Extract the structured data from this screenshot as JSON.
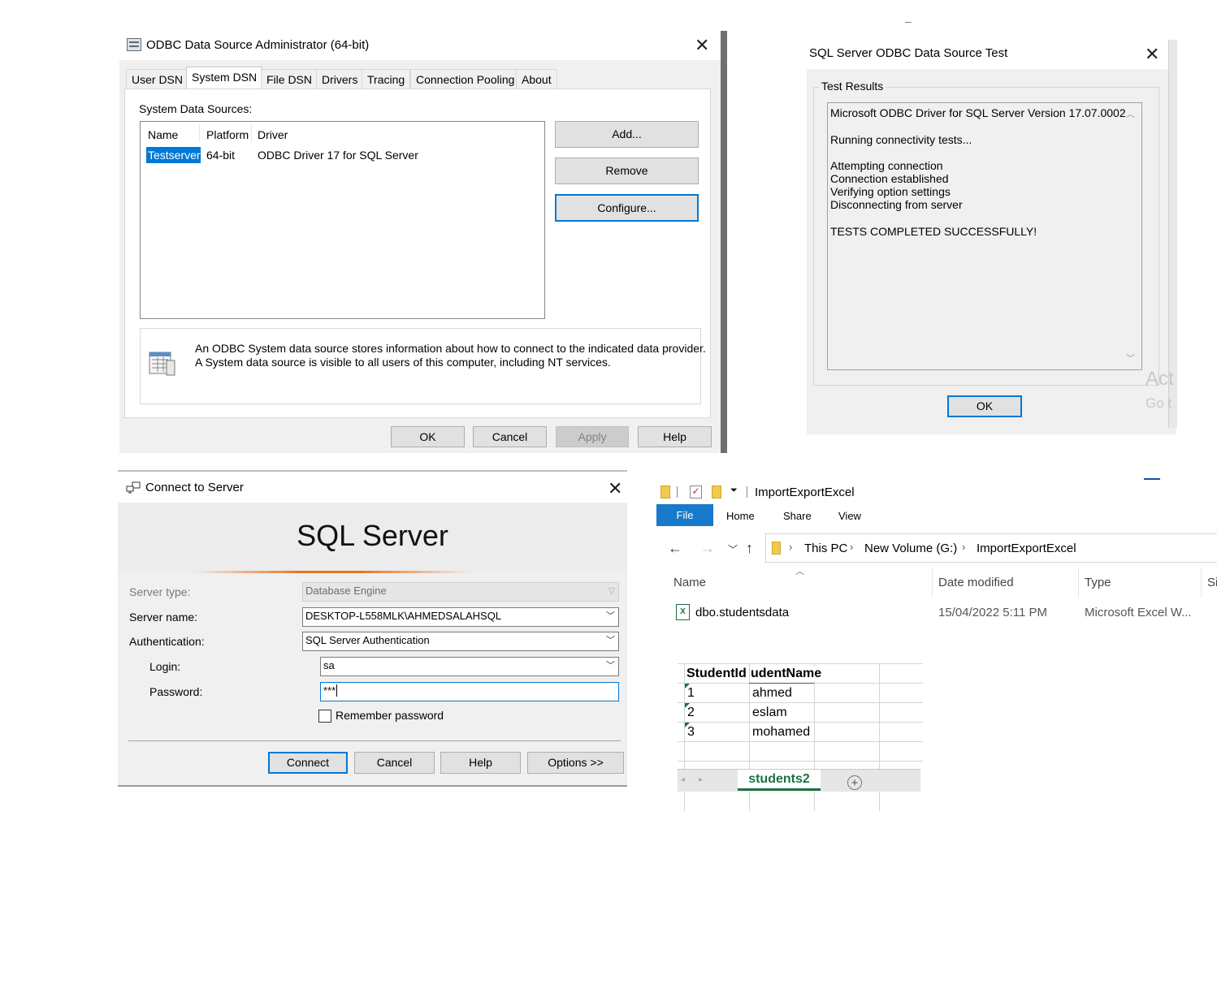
{
  "odbc": {
    "title": "ODBC Data Source Administrator (64-bit)",
    "tabs": [
      "User DSN",
      "System DSN",
      "File DSN",
      "Drivers",
      "Tracing",
      "Connection Pooling",
      "About"
    ],
    "active_tab": "System DSN",
    "section_label": "System Data Sources:",
    "columns": [
      "Name",
      "Platform",
      "Driver"
    ],
    "rows": [
      {
        "name": "Testserver",
        "platform": "64-bit",
        "driver": "ODBC Driver 17 for SQL Server"
      }
    ],
    "buttons": {
      "add": "Add...",
      "remove": "Remove",
      "configure": "Configure..."
    },
    "info_line1": "An ODBC System data source stores information about how to connect to the indicated data provider.",
    "info_line2": "A System data source is visible to all users of this computer, including NT services.",
    "footer": {
      "ok": "OK",
      "cancel": "Cancel",
      "apply": "Apply",
      "help": "Help"
    }
  },
  "test": {
    "title": "SQL Server ODBC Data Source Test",
    "group_label": "Test Results",
    "lines": {
      "version": "Microsoft ODBC Driver for SQL Server Version 17.07.0002",
      "running": "Running connectivity tests...",
      "attempting": "Attempting connection",
      "established": "Connection established",
      "verifying": "Verifying option settings",
      "disconnecting": "Disconnecting from server",
      "result": "TESTS COMPLETED SUCCESSFULLY!"
    },
    "ok": "OK",
    "watermark_1": "Act",
    "watermark_2": "Go t"
  },
  "connect": {
    "title": "Connect to Server",
    "banner": "SQL Server",
    "server_type_label": "Server type:",
    "server_type_value": "Database Engine",
    "server_name_label": "Server name:",
    "server_name_value": "DESKTOP-L558MLK\\AHMEDSALAHSQL",
    "auth_label": "Authentication:",
    "auth_value": "SQL Server Authentication",
    "login_label": "Login:",
    "login_value": "sa",
    "password_label": "Password:",
    "password_value": "***",
    "remember_label": "Remember password",
    "buttons": {
      "connect": "Connect",
      "cancel": "Cancel",
      "help": "Help",
      "options": "Options >>"
    }
  },
  "explorer": {
    "title": "ImportExportExcel",
    "ribbon_tabs": {
      "file": "File",
      "home": "Home",
      "share": "Share",
      "view": "View"
    },
    "breadcrumb": {
      "this_pc": "This PC",
      "volume": "New Volume (G:)",
      "folder": "ImportExportExcel"
    },
    "columns": {
      "name": "Name",
      "date": "Date modified",
      "type": "Type",
      "size": "Si"
    },
    "file": {
      "name": "dbo.studentsdata",
      "date": "15/04/2022 5:11 PM",
      "type": "Microsoft Excel W..."
    }
  },
  "sheet": {
    "headers": {
      "a": "StudentId",
      "b": "udentName"
    },
    "rows": [
      {
        "id": "1",
        "name": "ahmed"
      },
      {
        "id": "2",
        "name": "eslam"
      },
      {
        "id": "3",
        "name": "mohamed"
      }
    ],
    "tab_name": "students2"
  }
}
